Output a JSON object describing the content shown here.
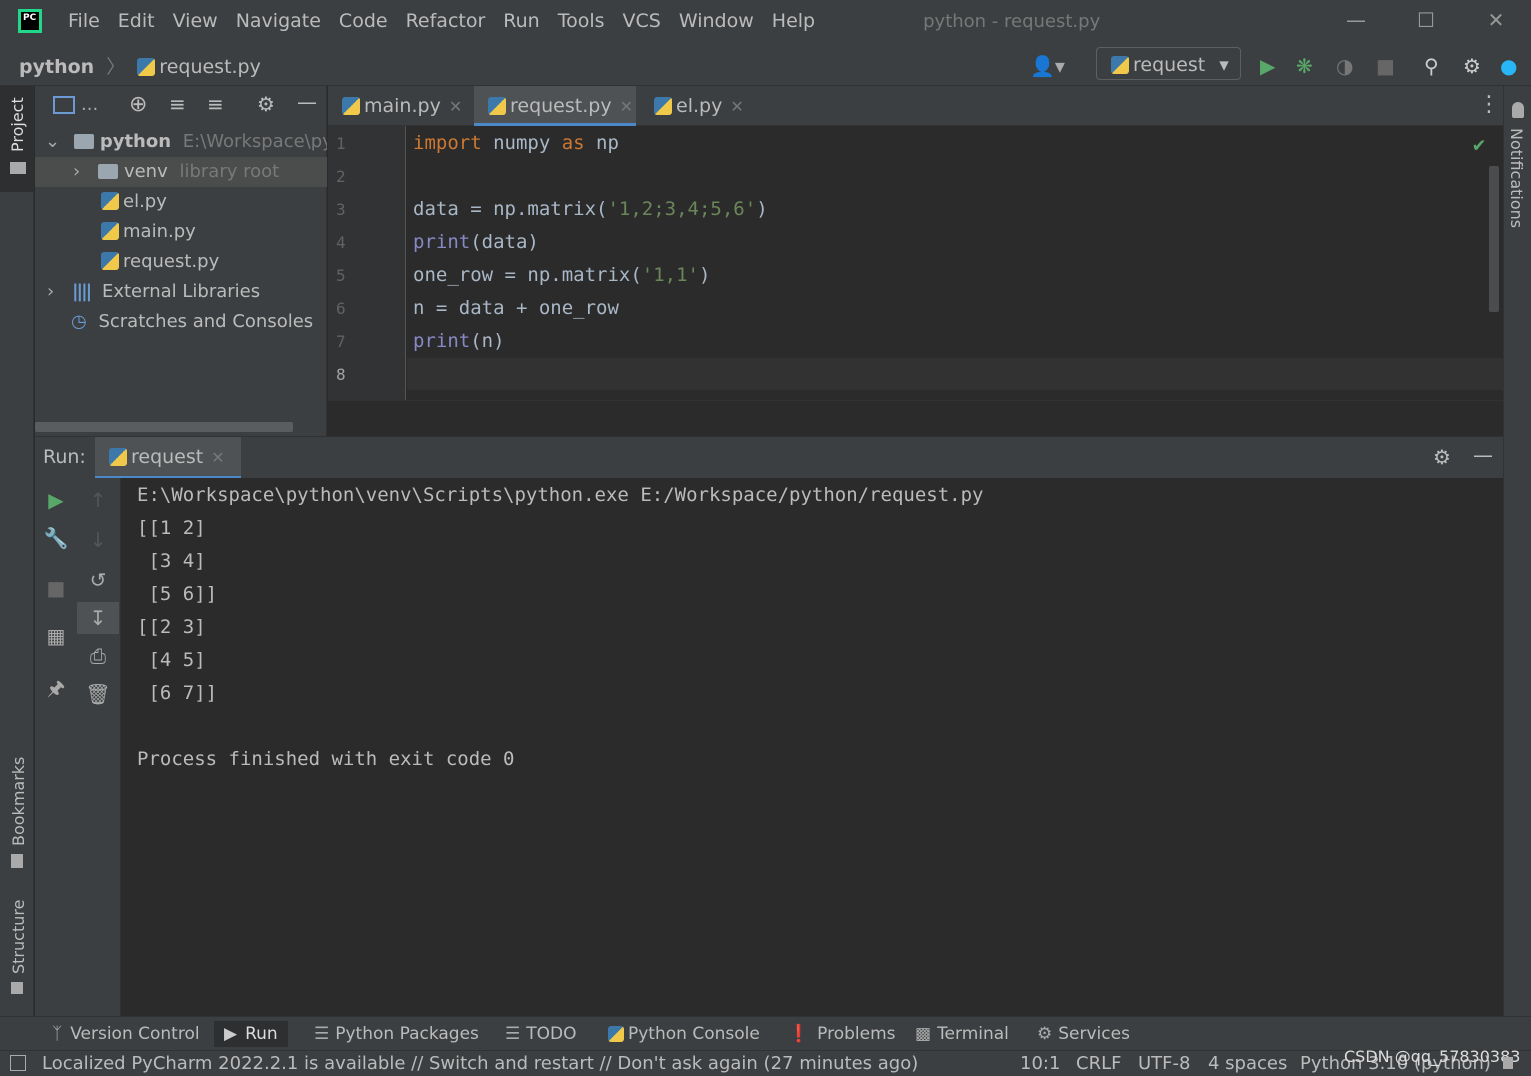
{
  "menu": [
    "File",
    "Edit",
    "View",
    "Navigate",
    "Code",
    "Refactor",
    "Run",
    "Tools",
    "VCS",
    "Window",
    "Help"
  ],
  "window_title": "python - request.py",
  "breadcrumb": {
    "project": "python",
    "file": "request.py"
  },
  "run_config": "request",
  "left_strip": {
    "project": "Project",
    "bookmarks": "Bookmarks",
    "structure": "Structure"
  },
  "right_strip": {
    "notifications": "Notifications"
  },
  "project_tree": {
    "root": {
      "name": "python",
      "path": "E:\\Workspace\\pyt"
    },
    "venv": {
      "name": "venv",
      "hint": "library root"
    },
    "files": [
      "el.py",
      "main.py",
      "request.py"
    ],
    "external": "External Libraries",
    "scratches": "Scratches and Consoles"
  },
  "tabs": [
    "main.py",
    "request.py",
    "el.py"
  ],
  "editor": {
    "line_numbers": [
      "1",
      "2",
      "3",
      "4",
      "5",
      "6",
      "7",
      "8"
    ]
  },
  "run_panel": {
    "label": "Run:",
    "tab": "request",
    "output": [
      "E:\\Workspace\\python\\venv\\Scripts\\python.exe E:/Workspace/python/request.py",
      "[[1 2]",
      " [3 4]",
      " [5 6]]",
      "[[2 3]",
      " [4 5]",
      " [6 7]]",
      "",
      "Process finished with exit code 0"
    ]
  },
  "tool_windows": [
    "Version Control",
    "Run",
    "Python Packages",
    "TODO",
    "Python Console",
    "Problems",
    "Terminal",
    "Services"
  ],
  "status": {
    "message": "Localized PyCharm 2022.2.1 is available // Switch and restart // Don't ask again (27 minutes ago)",
    "position": "10:1",
    "line_sep": "CRLF",
    "encoding": "UTF-8",
    "indent": "4 spaces",
    "interpreter": "Python 3.10 (python)",
    "watermark": "CSDN @qq_57830383"
  }
}
